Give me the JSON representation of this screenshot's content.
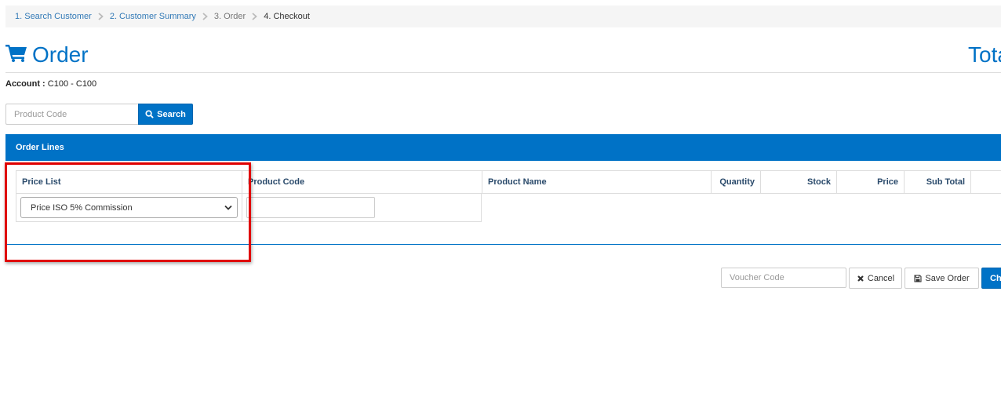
{
  "breadcrumb": {
    "step1": "1. Search Customer",
    "step2": "2. Customer Summary",
    "step3": "3. Order",
    "step4": "4. Checkout"
  },
  "header": {
    "title": "Order",
    "total_label": "Tota"
  },
  "account": {
    "label": "Account :",
    "value": "C100 - C100"
  },
  "search": {
    "placeholder": "Product Code",
    "button_label": "Search"
  },
  "order_lines": {
    "title": "Order Lines",
    "columns": [
      "Price List",
      "Product Code",
      "Product Name",
      "Quantity",
      "Stock",
      "Price",
      "Sub Total"
    ],
    "row": {
      "price_list_selected": "Price ISO 5% Commission",
      "product_code_value": ""
    }
  },
  "footer": {
    "voucher_placeholder": "Voucher Code",
    "cancel_label": "Cancel",
    "save_label": "Save Order",
    "checkout_label": "Ch"
  },
  "colors": {
    "primary": "#0072c6",
    "highlight": "#e00000",
    "link": "#337ab7"
  }
}
